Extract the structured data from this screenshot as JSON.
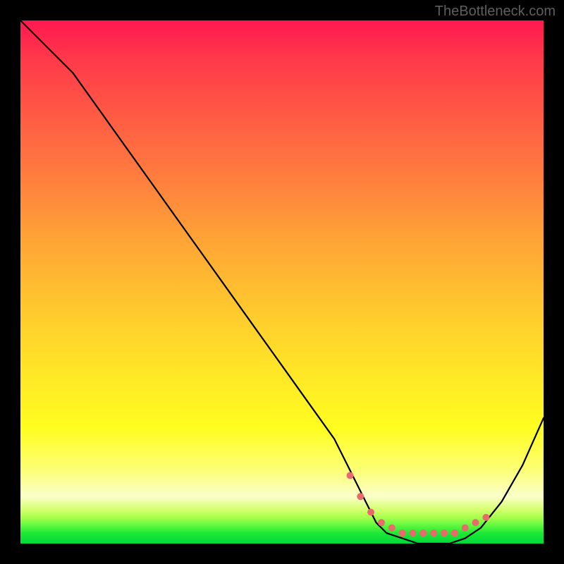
{
  "watermark": "TheBottleneck.com",
  "chart_data": {
    "type": "line",
    "title": "",
    "xlabel": "",
    "ylabel": "",
    "xlim": [
      0,
      100
    ],
    "ylim": [
      0,
      100
    ],
    "series": [
      {
        "name": "bottleneck-curve",
        "x": [
          0,
          5,
          10,
          15,
          20,
          25,
          30,
          35,
          40,
          45,
          50,
          55,
          60,
          63,
          66,
          68,
          70,
          73,
          76,
          79,
          82,
          85,
          88,
          92,
          96,
          100
        ],
        "values": [
          100,
          95,
          90,
          83,
          76,
          69,
          62,
          55,
          48,
          41,
          34,
          27,
          20,
          14,
          8,
          4,
          2,
          1,
          0,
          0,
          0,
          1,
          3,
          8,
          15,
          24
        ]
      },
      {
        "name": "optimal-range-dots",
        "x": [
          63,
          65,
          67,
          69,
          71,
          73,
          75,
          77,
          79,
          81,
          83,
          85,
          87,
          89
        ],
        "values": [
          13,
          9,
          6,
          4,
          3,
          2,
          2,
          2,
          2,
          2,
          2,
          3,
          4,
          5
        ]
      }
    ],
    "gradient_stops": [
      {
        "pos": 0,
        "color": "#ff1850"
      },
      {
        "pos": 0.5,
        "color": "#ffc82e"
      },
      {
        "pos": 0.85,
        "color": "#fffd20"
      },
      {
        "pos": 1.0,
        "color": "#00d93a"
      }
    ]
  }
}
